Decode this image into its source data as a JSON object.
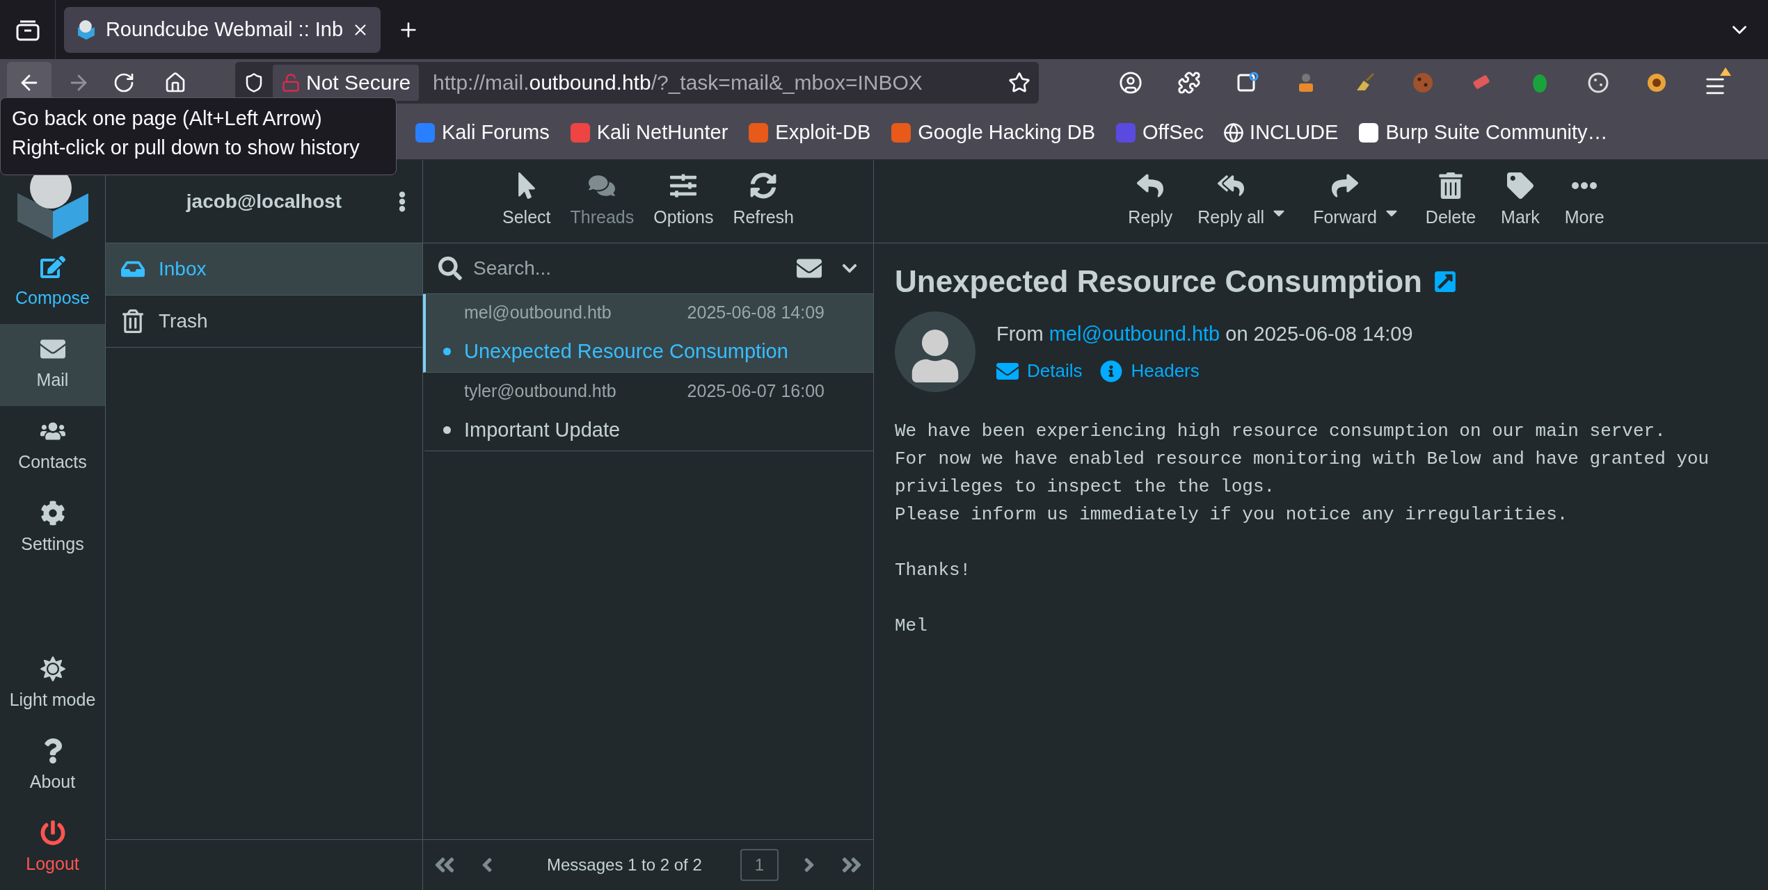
{
  "browser": {
    "tabs": [
      {
        "title": "Roundcube Webmail :: Inb",
        "selected": true
      }
    ],
    "url": {
      "security": "Not Secure",
      "parts": [
        {
          "text": "http://mail.",
          "emphasized": false
        },
        {
          "text": "outbound.htb",
          "emphasized": true
        },
        {
          "text": "/?_task=mail&_mbox=INBOX",
          "emphasized": false
        }
      ]
    },
    "bookmarks": [
      {
        "label": "Kali Forums"
      },
      {
        "label": "Kali NetHunter"
      },
      {
        "label": "Exploit-DB"
      },
      {
        "label": "Google Hacking DB"
      },
      {
        "label": "OffSec"
      },
      {
        "label": "INCLUDE"
      },
      {
        "label": "Burp Suite Community…"
      }
    ],
    "tooltip": {
      "lines": [
        "Go back one page (Alt+Left Arrow)",
        "Right-click or pull down to show history"
      ]
    }
  },
  "app": {
    "nav_top": [
      {
        "label": "Compose",
        "kind": "action",
        "selected": false
      },
      {
        "label": "Mail",
        "kind": "item",
        "selected": true
      },
      {
        "label": "Contacts",
        "kind": "item",
        "selected": false
      },
      {
        "label": "Settings",
        "kind": "item",
        "selected": false
      }
    ],
    "nav_bottom": [
      {
        "label": "Light mode",
        "kind": "item",
        "selected": false
      },
      {
        "label": "About",
        "kind": "item",
        "selected": false
      },
      {
        "label": "Logout",
        "kind": "danger",
        "selected": false
      }
    ],
    "account": "jacob@localhost",
    "folders": [
      {
        "label": "Inbox",
        "selected": true
      },
      {
        "label": "Trash",
        "selected": false
      }
    ],
    "list_toolbar": [
      {
        "label": "Select",
        "disabled": false
      },
      {
        "label": "Threads",
        "disabled": true
      },
      {
        "label": "Options",
        "disabled": false
      },
      {
        "label": "Refresh",
        "disabled": false
      }
    ],
    "search": {
      "placeholder": "Search..."
    },
    "messages": [
      {
        "from": "mel@outbound.htb",
        "date": "2025-06-08 14:09",
        "subject": "Unexpected Resource Consumption",
        "selected": true
      },
      {
        "from": "tyler@outbound.htb",
        "date": "2025-06-07 16:00",
        "subject": "Important Update",
        "selected": false
      }
    ],
    "list_footer": {
      "count": "Messages 1 to 2 of 2",
      "page": "1"
    },
    "message_toolbar": [
      {
        "label": "Reply",
        "has_menu": false
      },
      {
        "label": "Reply all",
        "has_menu": true
      },
      {
        "label": "Forward",
        "has_menu": true
      },
      {
        "label": "Delete",
        "has_menu": false
      },
      {
        "label": "Mark",
        "has_menu": false
      },
      {
        "label": "More",
        "has_menu": false
      }
    ],
    "message": {
      "subject": "Unexpected Resource Consumption",
      "from_label": "From",
      "sender": "mel@outbound.htb",
      "date_text": "on 2025-06-08 14:09",
      "links": [
        "Details",
        "Headers"
      ],
      "body": [
        [
          "We have been experiencing high resource consumption on our main server.",
          "For now we have enabled resource monitoring with Below and have granted you",
          "privileges to inspect the the logs.",
          "Please inform us immediately if you notice any irregularities."
        ],
        [
          "Thanks!"
        ],
        [
          "Mel"
        ]
      ]
    }
  }
}
